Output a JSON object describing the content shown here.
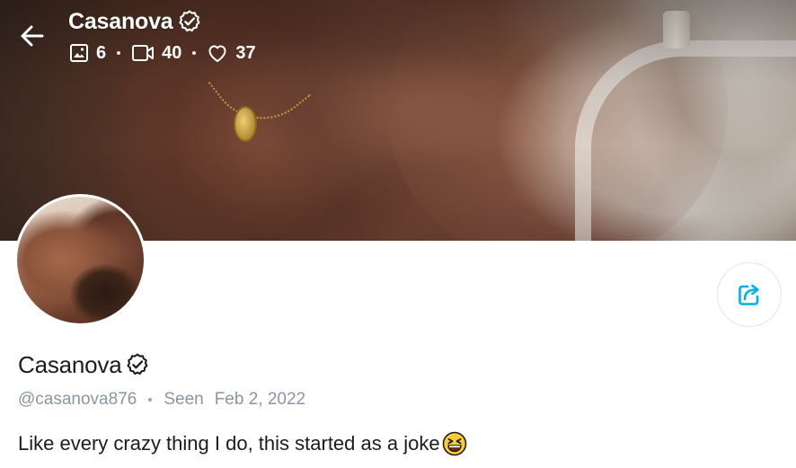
{
  "header": {
    "name": "Casanova",
    "stats": {
      "photos": "6",
      "videos": "40",
      "likes": "37"
    }
  },
  "profile": {
    "display_name": "Casanova",
    "handle": "@casanova876",
    "seen_label": "Seen",
    "seen_date": "Feb 2, 2022",
    "bio": "Like every crazy thing I do, this started as a joke"
  },
  "icons": {
    "back": "arrow-left-icon",
    "verified": "verified-badge-icon",
    "photos": "image-icon",
    "videos": "video-icon",
    "likes": "heart-icon",
    "share": "share-icon",
    "emoji": "grinning-squinting-face-emoji"
  },
  "colors": {
    "accent": "#00aff0",
    "text_primary": "#1c1c1c",
    "text_secondary": "#8a96a3",
    "header_text": "#ffffff"
  }
}
